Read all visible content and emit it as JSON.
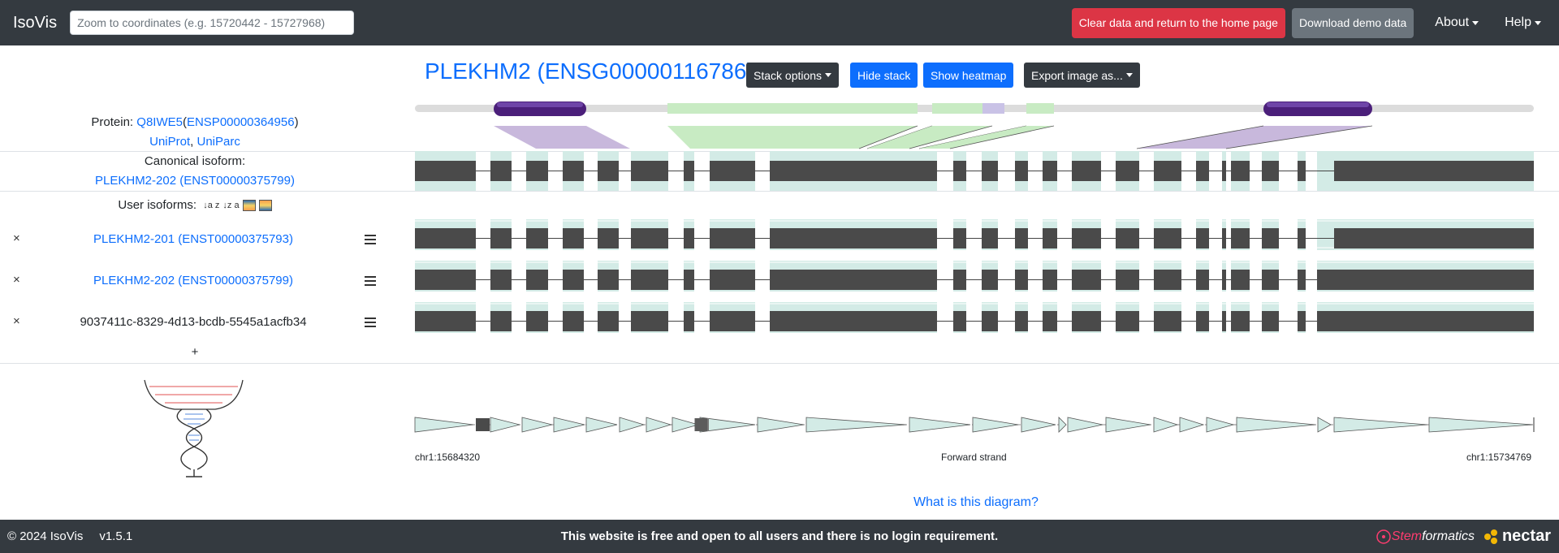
{
  "navbar": {
    "brand": "IsoVis",
    "coord_placeholder": "Zoom to coordinates (e.g. 15720442 - 15727968)",
    "clear_button": "Clear data and return to the home page",
    "demo_button": "Download demo data",
    "about": "About",
    "help": "Help"
  },
  "header": {
    "gene_title": "PLEKHM2 (ENSG00000116786)",
    "stack_options": "Stack options",
    "hide_stack": "Hide stack",
    "show_heatmap": "Show heatmap",
    "export_image": "Export image as..."
  },
  "protein": {
    "prefix": "Protein: ",
    "uniprot_id": "Q8IWE5",
    "ensp_id": "ENSP00000364956",
    "uniprot_link": "UniProt",
    "uniparc_link": "UniParc",
    "open_paren": "(",
    "close_paren": ")",
    "comma": ", "
  },
  "canonical": {
    "label": "Canonical isoform:",
    "isoform": "PLEKHM2-202 (ENST00000375799)"
  },
  "user_isoforms": {
    "label": "User isoforms:",
    "sort_asc_icon": "↓a z",
    "sort_desc_icon": "↓z a",
    "rows": [
      {
        "remove": "×",
        "name": "PLEKHM2-201 (ENST00000375793)",
        "is_link": true
      },
      {
        "remove": "×",
        "name": "PLEKHM2-202 (ENST00000375799)",
        "is_link": true
      },
      {
        "remove": "×",
        "name": "9037411c-8329-4d13-bcdb-5545a1acfb34",
        "is_link": false
      }
    ],
    "add": "+"
  },
  "axis": {
    "start": "chr1:15684320",
    "strand": "Forward strand",
    "end": "chr1:15734769"
  },
  "what_is": "What is this diagram?",
  "footer": {
    "copyright": "© 2024 IsoVis",
    "version": "v1.5.1",
    "message": "This website is free and open to all users and there is no login requirement.",
    "stemformatics_prefix": "Stem",
    "stemformatics_suffix": "formatics",
    "nectar": "nectar"
  },
  "colors": {
    "navbar": "#343a40",
    "primary": "#0d6efd",
    "danger": "#dc3545",
    "exon": "#4a4a4a",
    "exon_band": "#d3ebe6",
    "domain": "#5b2a8a",
    "domain_fill": "#c8b8dc",
    "region_green": "#c8ebc3"
  }
}
